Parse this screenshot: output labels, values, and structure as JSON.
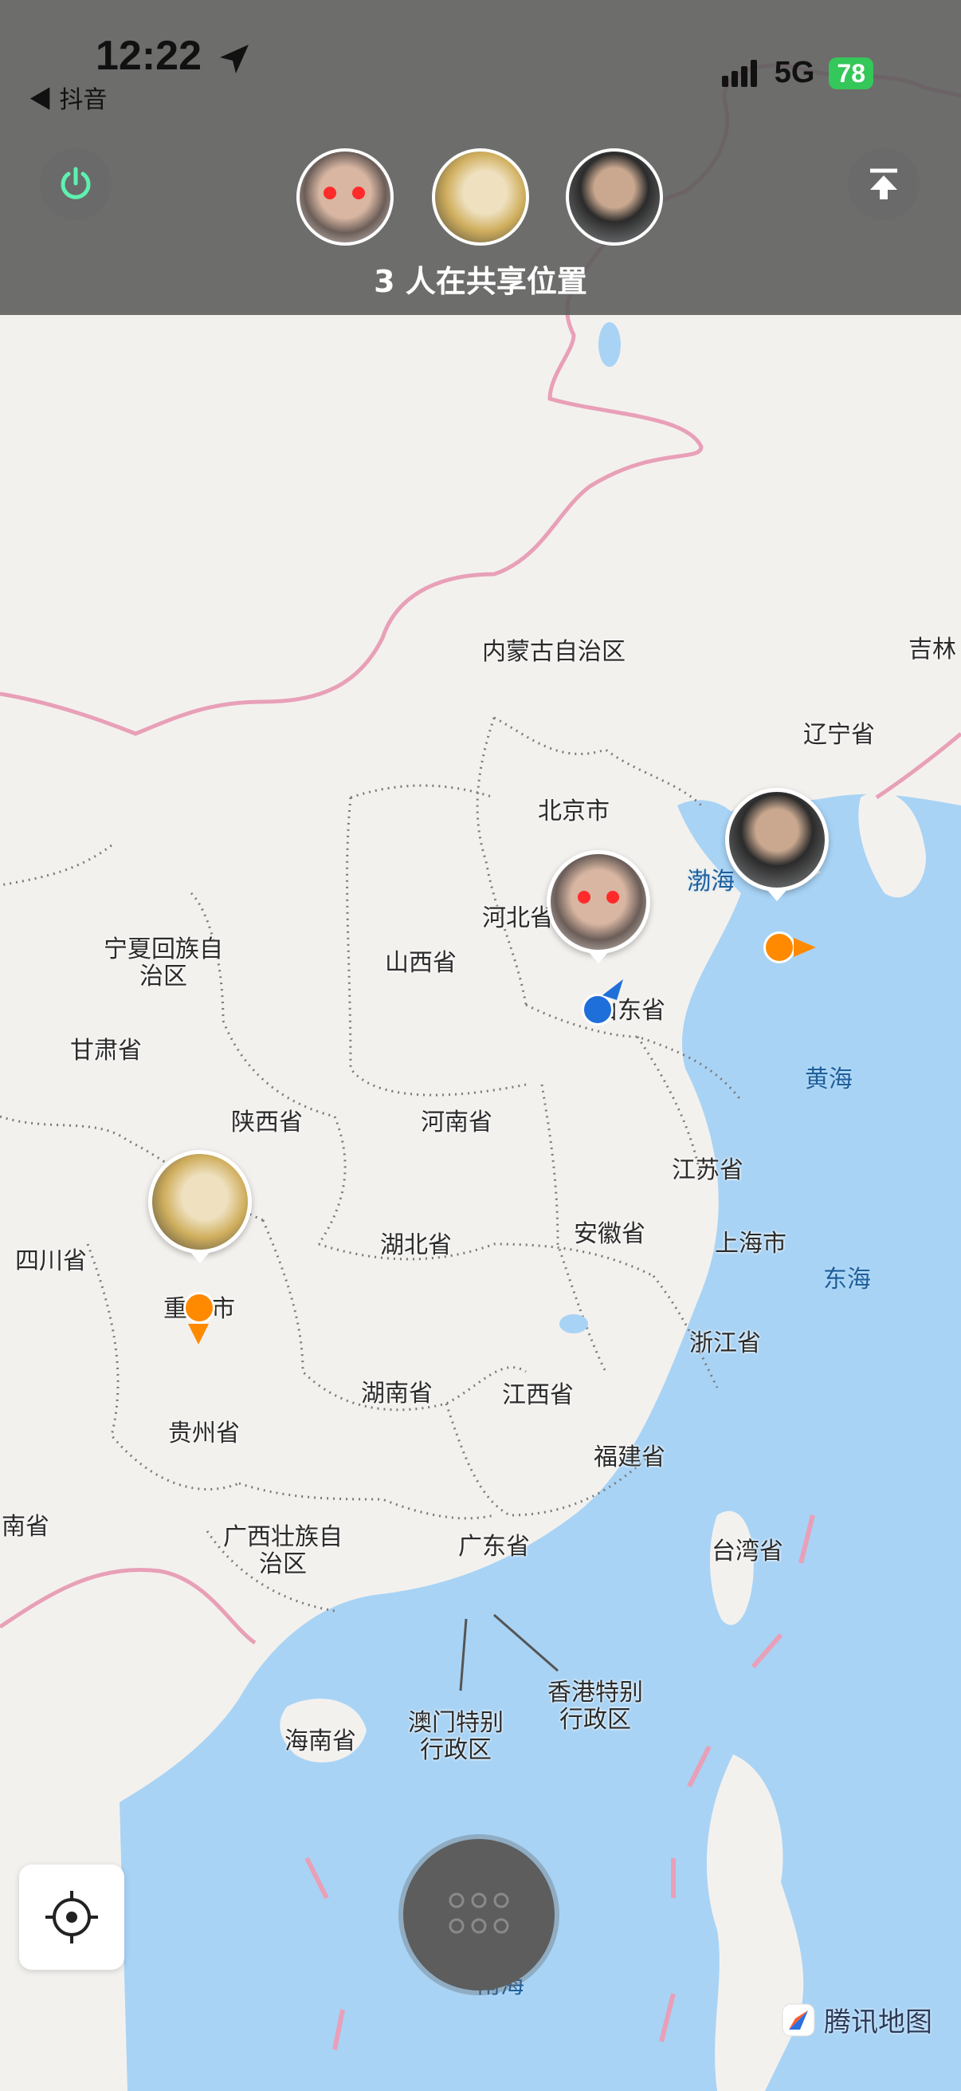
{
  "status_bar": {
    "time": "12:22",
    "back_label": "◀ 抖音",
    "network": "5G",
    "battery": "78"
  },
  "header": {
    "share_text": "3 人在共享位置"
  },
  "map": {
    "provinces": [
      "内蒙古自治区",
      "吉林",
      "辽宁省",
      "北京市",
      "河北省",
      "山西省",
      "宁夏回族自治区",
      "甘肃省",
      "陕西省",
      "河南省",
      "山东省",
      "江苏省",
      "安徽省",
      "上海市",
      "四川省",
      "重庆市",
      "湖北省",
      "浙江省",
      "湖南省",
      "江西省",
      "贵州省",
      "福建省",
      "南省",
      "广西壮族自治区",
      "广东省",
      "台湾省",
      "香港特别行政区",
      "澳门特别行政区",
      "海南省"
    ],
    "seas": [
      "渤海",
      "黄海",
      "东海",
      "南海"
    ]
  },
  "brand": {
    "name": "腾讯地图"
  },
  "colors": {
    "sea": "#a8d3f5",
    "land": "#f3f1ee",
    "border": "#e8a0b8",
    "orange": "#ff8a00",
    "blue": "#1e6fd9",
    "accent_green": "#34c759"
  }
}
